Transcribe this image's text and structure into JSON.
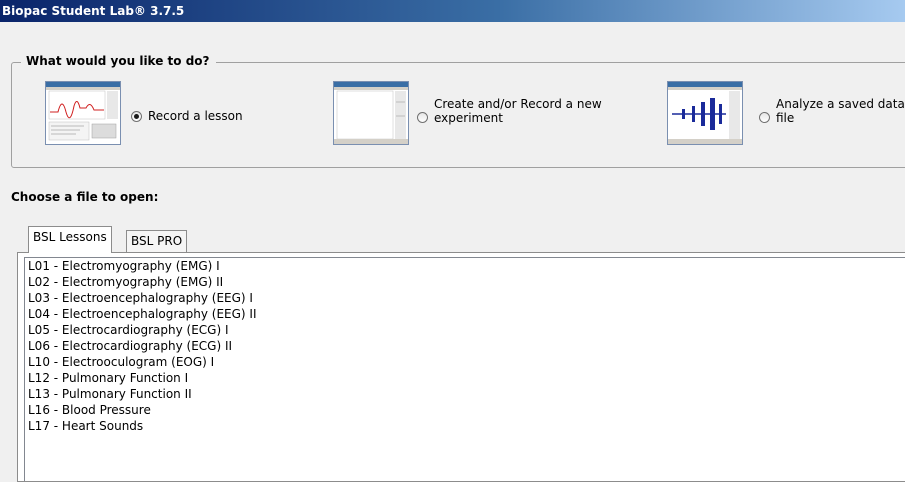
{
  "window": {
    "title": "Biopac Student Lab® 3.7.5"
  },
  "action_group": {
    "legend": "What would you like to do?",
    "options": [
      {
        "label": "Record a lesson",
        "selected": true,
        "thumbnail": "lesson-waveform-thumbnail"
      },
      {
        "label": "Create and/or Record a new experiment",
        "selected": false,
        "thumbnail": "blank-experiment-thumbnail"
      },
      {
        "label": "Analyze a saved data file",
        "selected": false,
        "thumbnail": "saved-data-thumbnail"
      }
    ]
  },
  "file_chooser": {
    "label": "Choose a file to open:",
    "tabs": [
      {
        "label": "BSL Lessons",
        "active": true
      },
      {
        "label": "BSL PRO",
        "active": false
      }
    ],
    "lessons": [
      "L01 - Electromyography (EMG) I",
      "L02 - Electromyography (EMG) II",
      "L03 - Electroencephalography (EEG) I",
      "L04 - Electroencephalography (EEG) II",
      "L05 - Electrocardiography (ECG) I",
      "L06 - Electrocardiography (ECG) II",
      "L10 - Electrooculogram (EOG) I",
      "L12 - Pulmonary Function I",
      "L13 - Pulmonary Function II",
      "L16 - Blood Pressure",
      "L17 - Heart Sounds"
    ]
  },
  "colors": {
    "titlebar_start": "#0a246a",
    "titlebar_end": "#a6caf0",
    "waveform_red": "#d02020",
    "waveform_blue": "#1a2a9a"
  }
}
